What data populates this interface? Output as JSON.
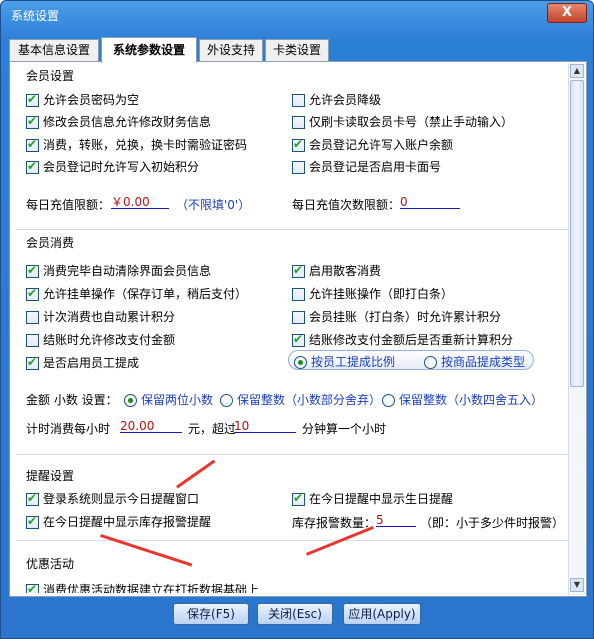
{
  "window": {
    "title": "系统设置",
    "close_label": "X"
  },
  "tabs": [
    {
      "label": "基本信息设置"
    },
    {
      "label": "系统参数设置"
    },
    {
      "label": "外设支持"
    },
    {
      "label": "卡类设置"
    }
  ],
  "member_settings": {
    "title": "会员设置",
    "options": [
      {
        "label": "允许会员密码为空",
        "checked": true
      },
      {
        "label": "允许会员降级",
        "checked": false
      },
      {
        "label": "修改会员信息允许修改财务信息",
        "checked": true
      },
      {
        "label": "仅刷卡读取会员卡号（禁止手动输入）",
        "checked": false
      },
      {
        "label": "消费，转账，兑换，换卡时需验证密码",
        "checked": true
      },
      {
        "label": "会员登记允许写入账户余额",
        "checked": true
      },
      {
        "label": "会员登记时允许写入初始积分",
        "checked": true
      },
      {
        "label": "会员登记是否启用卡面号",
        "checked": false
      }
    ],
    "daily_limit_label": "每日充值限额：",
    "daily_limit_value": "￥0.00",
    "daily_limit_hint": "（不限填'0'）",
    "daily_count_label": "每日充值次数限额：",
    "daily_count_value": "0"
  },
  "member_consume": {
    "title": "会员消费",
    "options": [
      {
        "label": "消费完毕自动清除界面会员信息",
        "checked": true
      },
      {
        "label": "启用散客消费",
        "checked": true
      },
      {
        "label": "允许挂单操作（保存订单，稍后支付）",
        "checked": true
      },
      {
        "label": "允许挂账操作（即打白条）",
        "checked": false
      },
      {
        "label": "计次消费也自动累计积分",
        "checked": false
      },
      {
        "label": "会员挂账（打白条）时允许累计积分",
        "checked": false
      },
      {
        "label": "结账时允许修改支付金额",
        "checked": false
      },
      {
        "label": "结账修改支付金额后是否重新计算积分",
        "checked": true
      },
      {
        "label": "是否启用员工提成",
        "checked": true
      }
    ],
    "commission_options": [
      {
        "label": "按员工提成比例",
        "selected": true
      },
      {
        "label": "按商品提成类型",
        "selected": false
      }
    ],
    "decimal_label": "金额 小数 设置：",
    "decimal_options": [
      {
        "label": "保留两位小数",
        "selected": true
      },
      {
        "label": "保留整数（小数部分舍弃）",
        "selected": false
      },
      {
        "label": "保留整数（小数四舍五入）",
        "selected": false
      }
    ],
    "timing_prefix": "计时消费每小时",
    "timing_price": "20.00",
    "timing_mid": "元，超过",
    "timing_minutes": "10",
    "timing_suffix": "分钟算一个小时"
  },
  "reminder": {
    "title": "提醒设置",
    "options": [
      {
        "label": "登录系统则显示今日提醒窗口",
        "checked": true
      },
      {
        "label": "在今日提醒中显示生日提醒",
        "checked": true
      },
      {
        "label": "在今日提醒中显示库存报警提醒",
        "checked": true
      }
    ],
    "stock_label": "库存报警数量：",
    "stock_value": "5",
    "stock_hint": "（即：小于多少件时报警）"
  },
  "promo": {
    "title": "优惠活动",
    "options": [
      {
        "label": "消费优惠活动数据建立在打折数据基础上",
        "checked": true
      }
    ]
  },
  "buttons": {
    "save": "保存(F5)",
    "close": "关闭(Esc)",
    "apply": "应用(Apply)"
  },
  "colors": {
    "title_bar": "#2c7fd6",
    "accent_text": "#1a3fbf",
    "checkmark": "#21a121",
    "annotation_arrow": "#e8352f"
  }
}
